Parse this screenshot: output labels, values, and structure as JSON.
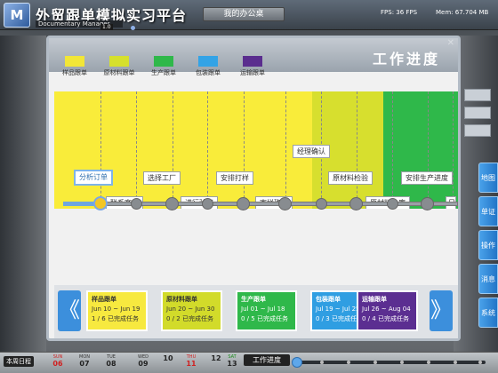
{
  "app": {
    "title": "外贸跟单模拟实习平台",
    "subtitle": "Documentary Manager",
    "version": "1.0",
    "desk_label": "我的办公桌",
    "fps": "FPS:     36 FPS",
    "mem": "Mem:     67.704 MB"
  },
  "modal": {
    "title": "工作进度",
    "legend": [
      {
        "label": "样品跟单",
        "color": "#f2e637"
      },
      {
        "label": "原材料跟单",
        "color": "#d6e02d"
      },
      {
        "label": "生产跟单",
        "color": "#2fb84a"
      },
      {
        "label": "包装跟单",
        "color": "#33a3e6"
      },
      {
        "label": "运输跟单",
        "color": "#5a2d8e"
      }
    ],
    "tasks": [
      {
        "label": "分析订单",
        "selected": true
      },
      {
        "label": "联系客户"
      },
      {
        "label": "选择工厂"
      },
      {
        "label": "进行验厂"
      },
      {
        "label": "安排打样"
      },
      {
        "label": "寄样确认"
      },
      {
        "label": "经理确认"
      },
      {
        "label": "原材料检验"
      },
      {
        "label": "原材料入库"
      },
      {
        "label": "安排生产进度"
      },
      {
        "label": "日"
      }
    ],
    "cards": [
      {
        "title": "样品跟单",
        "dates": "Jun 10 ~ Jun 19",
        "status": "1 / 6 已完成任务",
        "color": "#f7e93f",
        "text": "#333"
      },
      {
        "title": "原材料跟单",
        "dates": "Jun 20 ~ Jun 30",
        "status": "0 / 2 已完成任务",
        "color": "#d2db2a",
        "text": "#333"
      },
      {
        "title": "生产跟单",
        "dates": "Jul 01 ~ Jul 18",
        "status": "0 / 5 已完成任务",
        "color": "#2fb84a",
        "text": "#fff"
      },
      {
        "title": "包装跟单",
        "dates": "Jul 19 ~ Jul 25",
        "status": "0 / 3 已完成任务",
        "color": "#2f9ee2",
        "text": "#fff"
      },
      {
        "title": "运输跟单",
        "dates": "Jul 26 ~ Aug 04",
        "status": "0 / 4 已完成任务",
        "color": "#5b2e91",
        "text": "#fff"
      }
    ],
    "nav_prev": "《",
    "nav_next": "》"
  },
  "dock": [
    {
      "label": "地图"
    },
    {
      "label": "单证"
    },
    {
      "label": "操作"
    },
    {
      "label": "消息"
    },
    {
      "label": "系统"
    }
  ],
  "calendar": {
    "label": "本周日程",
    "days": [
      {
        "name": "SUN",
        "num": "06"
      },
      {
        "name": "MON",
        "num": "07"
      },
      {
        "name": "TUE",
        "num": "08"
      },
      {
        "name": "WED",
        "num": "09"
      },
      {
        "name": "",
        "num": "10"
      },
      {
        "name": "THU",
        "num": "11"
      },
      {
        "name": "",
        "num": "12"
      },
      {
        "name": "SAT",
        "num": "13"
      }
    ],
    "progress_label": "工作进度"
  }
}
